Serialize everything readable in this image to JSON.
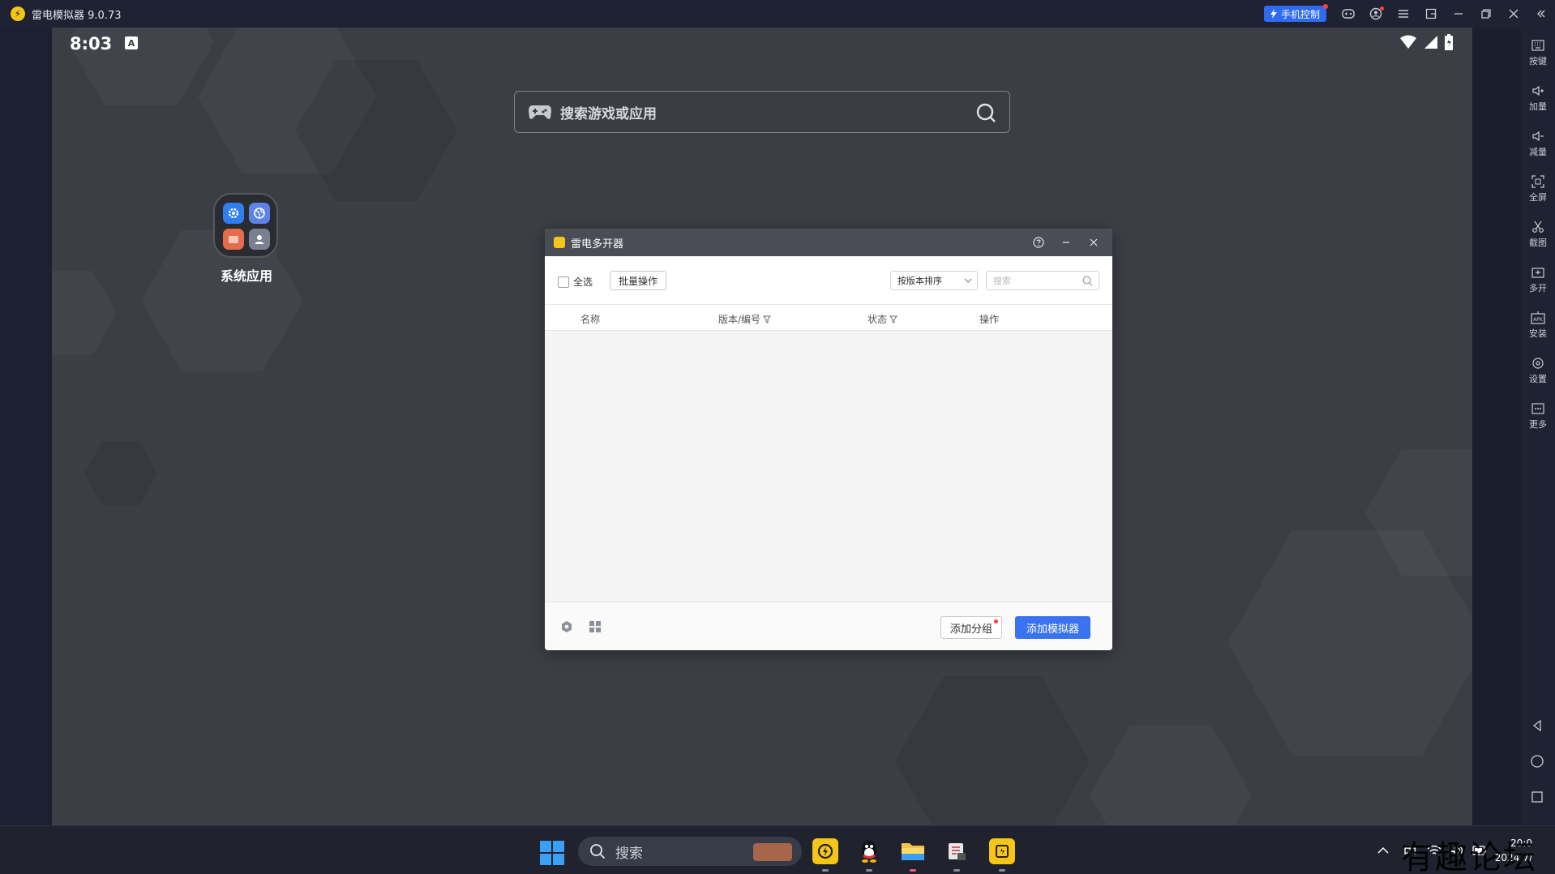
{
  "window": {
    "title": "雷电模拟器 9.0.73",
    "phone_control_label": "手机控制"
  },
  "status_bar": {
    "time": "8:03",
    "indicator": "A"
  },
  "home": {
    "search_placeholder": "搜索游戏或应用",
    "folder_label": "系统应用"
  },
  "dialog": {
    "title": "雷电多开器",
    "select_all": "全选",
    "batch_button": "批量操作",
    "sort_value": "按版本排序",
    "search_placeholder": "搜索",
    "columns": [
      "名称",
      "版本/编号",
      "状态",
      "操作"
    ],
    "add_group_button": "添加分组",
    "add_emulator_button": "添加模拟器"
  },
  "right_toolbar": {
    "items": [
      "按键",
      "加量",
      "减量",
      "全屏",
      "截图",
      "多开",
      "安装",
      "设置",
      "更多"
    ]
  },
  "taskbar": {
    "search_label": "搜索",
    "input_method": "中",
    "clock_time": "20:0",
    "clock_date": "2024/7/"
  },
  "watermark": "有趣论坛",
  "colors": {
    "accent": "#3a73f0",
    "brand": "#f5c518",
    "titlebar": "#1f2232",
    "desktop": "#3b3e44"
  }
}
